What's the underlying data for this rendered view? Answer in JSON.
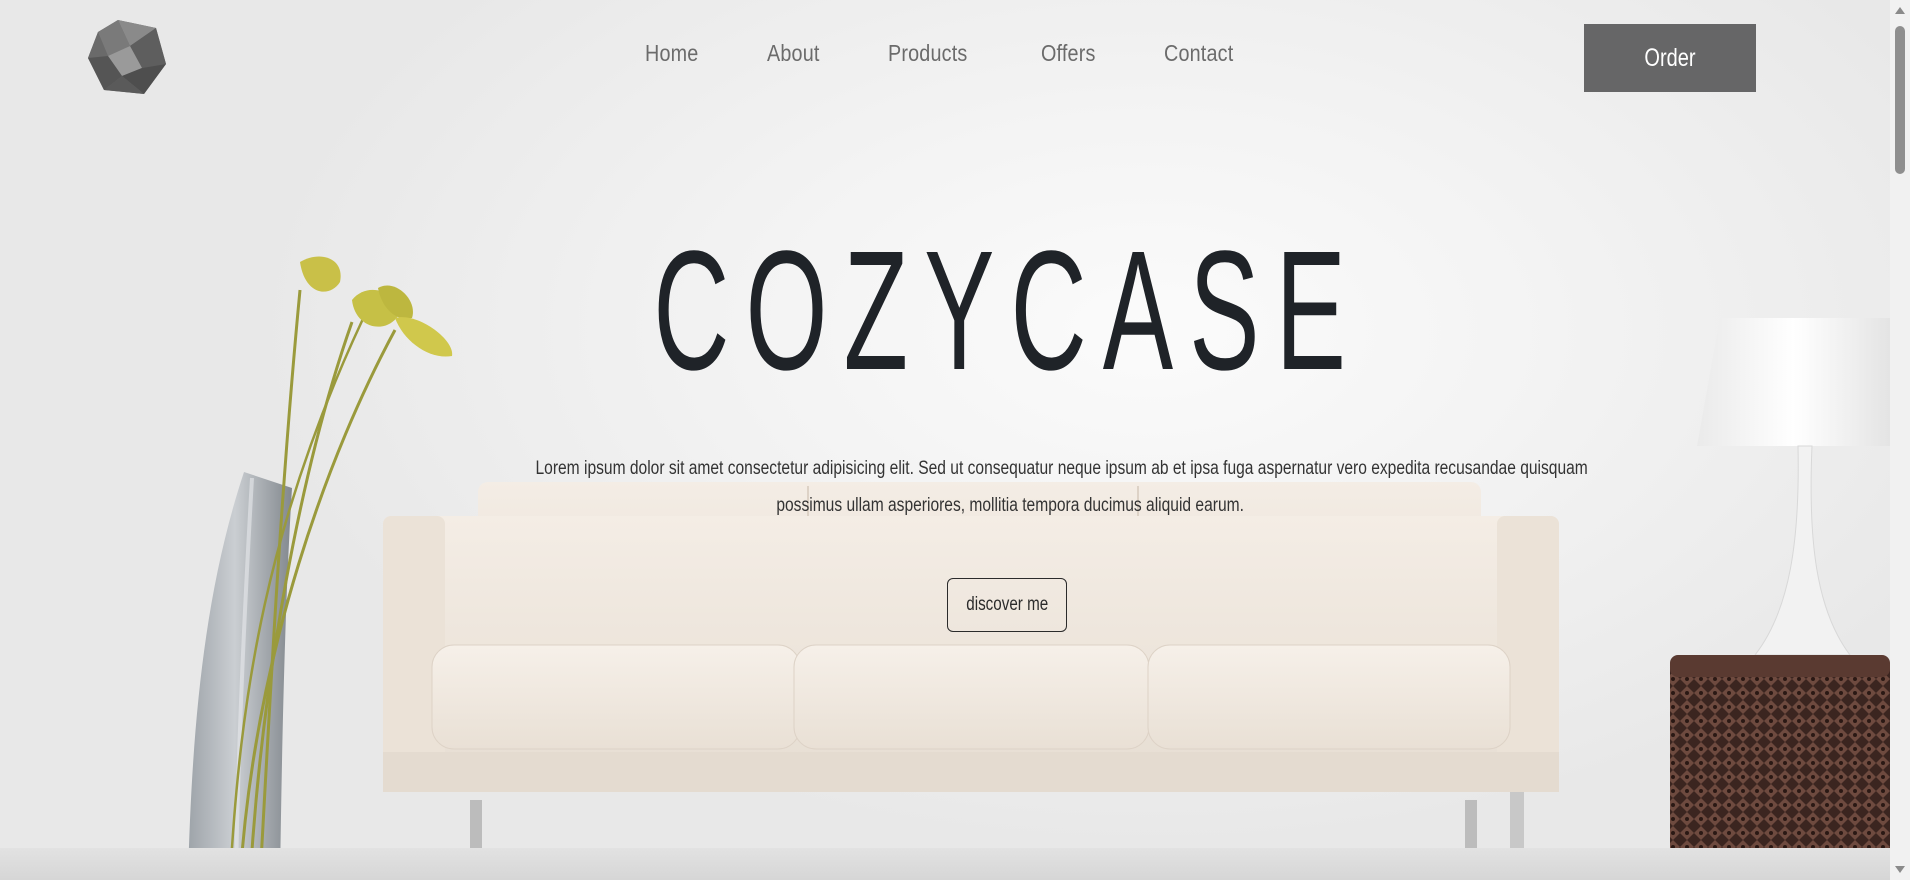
{
  "header": {
    "logo_icon": "icosahedron-logo-icon",
    "nav": [
      "Home",
      "About",
      "Products",
      "Offers",
      "Contact"
    ],
    "order_label": "Order"
  },
  "hero": {
    "title": "COZYCASE",
    "text": [
      "Lorem ipsum dolor sit amet consectetur adipisicing elit. Sed ut consequatur neque ipsum ab et ipsa fuga aspernatur vero expedita recusandae quisquam",
      "possimus ullam asperiores, mollitia tempora ducimus aliquid earum."
    ],
    "cta_label": "discover me"
  },
  "colors": {
    "order_button": "#666667",
    "title_text": "#1f2328",
    "nav_text": "#6b6b6b",
    "sofa": "#efe6dc",
    "flowers": "#c9c048",
    "side_table": "#4a2e26"
  }
}
